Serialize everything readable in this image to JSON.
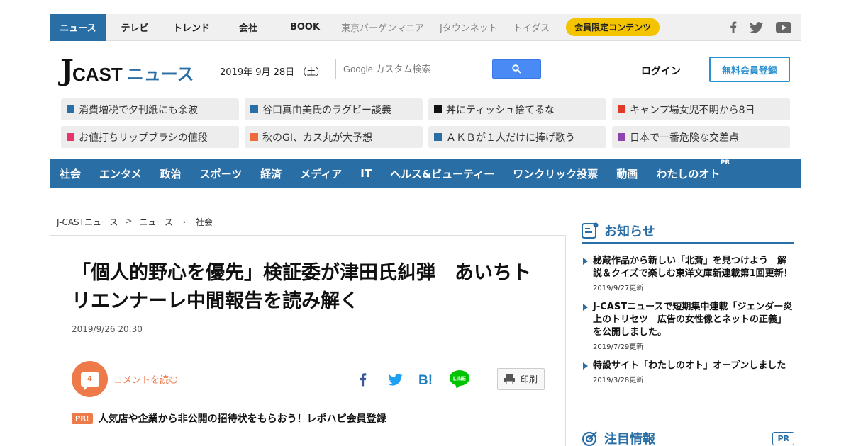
{
  "topnav": {
    "items": [
      "ニュース",
      "テレビ",
      "トレンド",
      "会社",
      "BOOK"
    ],
    "grey_items": [
      "東京バーゲンマニア",
      "Jタウンネット",
      "トイダス"
    ],
    "member_badge": "会員限定コンテンツ",
    "socials": [
      "facebook-icon",
      "twitter-icon",
      "youtube-icon"
    ]
  },
  "header": {
    "logo_j": "J",
    "logo_cast": "CAST",
    "logo_news": "ニュース",
    "date": "2019年 9月 28日 （土）",
    "search_placeholder": "Google カスタム検索",
    "login": "ログイン",
    "register": "無料会員登録"
  },
  "topics": [
    {
      "label": "消費増税で夕刊紙にも余波",
      "color": "#2a6ea6"
    },
    {
      "label": "谷口真由美氏のラグビー談義",
      "color": "#2a6ea6"
    },
    {
      "label": "丼にティッシュ捨てるな",
      "color": "#111111"
    },
    {
      "label": "キャンプ場女児不明から8日",
      "color": "#e03a2a"
    },
    {
      "label": "お値打ちリップブラシの値段",
      "color": "#e8336b"
    },
    {
      "label": "秋のGI、カス丸が大予想",
      "color": "#ee6a3a"
    },
    {
      "label": "ＡＫＢが１人だけに捧げ歌う",
      "color": "#2a6ea6"
    },
    {
      "label": "日本で一番危険な交差点",
      "color": "#8e44ad"
    }
  ],
  "categories": [
    "社会",
    "エンタメ",
    "政治",
    "スポーツ",
    "経済",
    "メディア",
    "IT",
    "ヘルス&ビューティー",
    "ワンクリック投票",
    "動画",
    "わたしのオト"
  ],
  "category_pr": "PR",
  "breadcrumb": {
    "home": "J-CASTニュース",
    "sep1": ">",
    "section": "ニュース",
    "sep2": "・",
    "category": "社会"
  },
  "article": {
    "title": "「個人的野心を優先」検証委が津田氏糾弾　あいちトリエンナーレ中間報告を読み解く",
    "date": "2019/9/26 20:30",
    "comment_count": "4",
    "comment_link": "コメントを読む",
    "print": "印刷",
    "pr_tag": "PR!",
    "pr_link": "人気店や企業から非公開の招待状をもらおう！レポハピ会員登録"
  },
  "sidebar": {
    "notice_heading": "お知らせ",
    "notices": [
      {
        "text": "秘蔵作品から新しい「北斎」を見つけよう　解説＆クイズで楽しむ東洋文庫新連載第1回更新！",
        "date": "2019/9/27更新"
      },
      {
        "text": "J-CASTニュースで短期集中連載「ジェンダー炎上のトリセツ　広告の女性像とネットの正義」を公開しました。",
        "date": "2019/7/29更新"
      },
      {
        "text": "特設サイト「わたしのオト」オープンしました",
        "date": "2019/3/28更新"
      }
    ],
    "attention_heading": "注目情報",
    "attention_pr": "PR"
  }
}
